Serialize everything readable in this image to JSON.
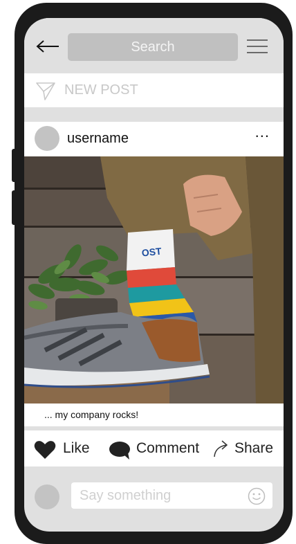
{
  "search": {
    "placeholder": "Search"
  },
  "new_post": {
    "label": "NEW POST"
  },
  "post": {
    "username": "username",
    "more": "...",
    "caption": "... my company rocks!",
    "sock_logo": "OST"
  },
  "actions": {
    "like": "Like",
    "comment": "Comment",
    "share": "Share"
  },
  "comment_box": {
    "placeholder": "Say something"
  },
  "icons": [
    "back-arrow-icon",
    "hamburger-menu-icon",
    "paper-plane-icon",
    "heart-icon",
    "speech-bubble-icon",
    "share-arrow-icon",
    "smiley-icon"
  ],
  "colors": {
    "device": "#1b1b1b",
    "screen_bg": "#e0e0e0",
    "search_bg": "#c0c0c0",
    "avatar": "#c3c3c3"
  }
}
